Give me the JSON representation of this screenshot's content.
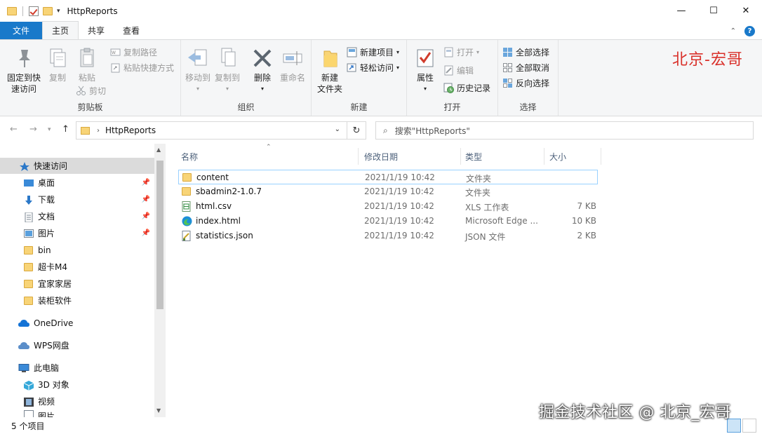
{
  "window": {
    "title": "HttpReports",
    "controls": {
      "minimize": "—",
      "maximize": "☐",
      "close": "✕"
    }
  },
  "ribbon_tabs": [
    {
      "label": "文件"
    },
    {
      "label": "主页"
    },
    {
      "label": "共享"
    },
    {
      "label": "查看"
    }
  ],
  "ribbon": {
    "clipboard": {
      "label": "剪贴板",
      "pin": "固定到快\n速访问",
      "pin_l1": "固定到快",
      "pin_l2": "速访问",
      "copy": "复制",
      "paste": "粘贴",
      "copy_path": "复制路径",
      "paste_shortcut": "粘贴快捷方式",
      "cut": "剪切"
    },
    "organize": {
      "label": "组织",
      "move_to": "移动到",
      "copy_to": "复制到",
      "delete": "删除",
      "rename": "重命名"
    },
    "new": {
      "label": "新建",
      "new_folder_l1": "新建",
      "new_folder_l2": "文件夹",
      "new_item": "新建项目",
      "easy_access": "轻松访问"
    },
    "open": {
      "label": "打开",
      "properties": "属性",
      "open": "打开",
      "edit": "编辑",
      "history": "历史记录"
    },
    "select": {
      "label": "选择",
      "select_all": "全部选择",
      "select_none": "全部取消",
      "invert": "反向选择"
    },
    "brand": "北京-宏哥"
  },
  "address": {
    "path": "HttpReports",
    "search_placeholder": "搜索\"HttpReports\""
  },
  "nav": {
    "quick_access": "快速访问",
    "items": [
      {
        "label": "桌面",
        "pinned": true
      },
      {
        "label": "下载",
        "pinned": true
      },
      {
        "label": "文档",
        "pinned": true
      },
      {
        "label": "图片",
        "pinned": true
      },
      {
        "label": "bin",
        "pinned": false
      },
      {
        "label": "超卡M4",
        "pinned": false
      },
      {
        "label": "宜家家居",
        "pinned": false
      },
      {
        "label": "装柜软件",
        "pinned": false
      }
    ],
    "onedrive": "OneDrive",
    "wps": "WPS网盘",
    "this_pc": "此电脑",
    "pc_items": [
      {
        "label": "3D 对象"
      },
      {
        "label": "视频"
      },
      {
        "label": "图片"
      }
    ]
  },
  "columns": {
    "name": "名称",
    "date": "修改日期",
    "type": "类型",
    "size": "大小"
  },
  "files": [
    {
      "name": "content",
      "date": "2021/1/19 10:42",
      "type": "文件夹",
      "size": "",
      "icon": "folder-icon"
    },
    {
      "name": "sbadmin2-1.0.7",
      "date": "2021/1/19 10:42",
      "type": "文件夹",
      "size": "",
      "icon": "folder-icon"
    },
    {
      "name": "html.csv",
      "date": "2021/1/19 10:42",
      "type": "XLS 工作表",
      "size": "7 KB",
      "icon": "csv-file-icon"
    },
    {
      "name": "index.html",
      "date": "2021/1/19 10:42",
      "type": "Microsoft Edge ...",
      "size": "10 KB",
      "icon": "edge-icon"
    },
    {
      "name": "statistics.json",
      "date": "2021/1/19 10:42",
      "type": "JSON 文件",
      "size": "2 KB",
      "icon": "json-file-icon"
    }
  ],
  "status": {
    "count": "5 个项目",
    "watermark": "掘金技术社区 @ 北京_宏哥"
  }
}
